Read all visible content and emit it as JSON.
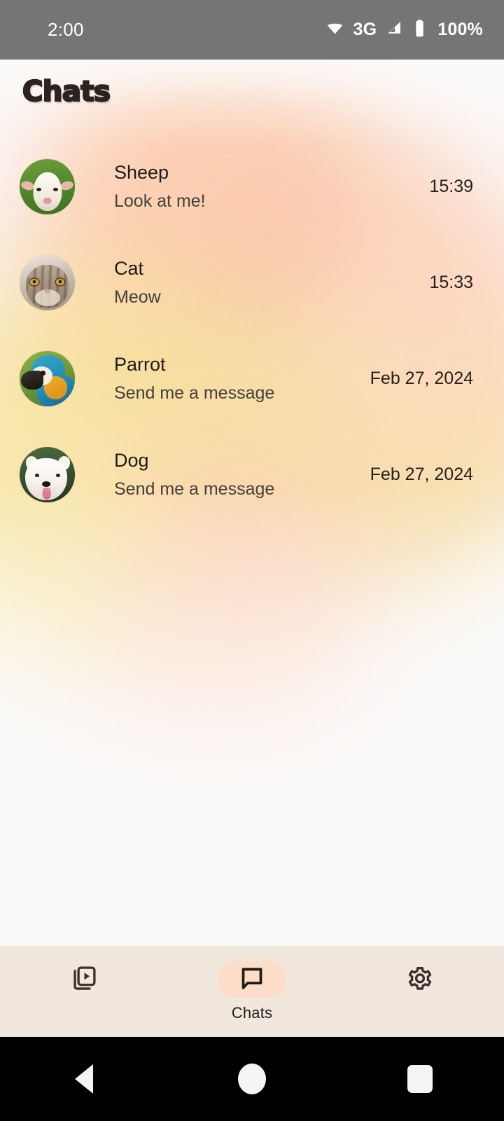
{
  "status_bar": {
    "clock": "2:00",
    "network": "3G",
    "battery": "100%",
    "wifi_icon": "wifi-icon",
    "signal_icon": "signal-icon",
    "battery_icon": "battery-icon",
    "background_color": "#757575",
    "text_color": "#ffffff"
  },
  "header": {
    "title": "Chats",
    "title_color": "#2b2320"
  },
  "chats": [
    {
      "name": "Sheep",
      "message": "Look at me!",
      "time": "15:39",
      "avatar": "sheep-avatar"
    },
    {
      "name": "Cat",
      "message": "Meow",
      "time": "15:33",
      "avatar": "cat-avatar"
    },
    {
      "name": "Parrot",
      "message": "Send me a message",
      "time": "Feb 27, 2024",
      "avatar": "parrot-avatar"
    },
    {
      "name": "Dog",
      "message": "Send me a message",
      "time": "Feb 27, 2024",
      "avatar": "dog-avatar"
    }
  ],
  "bottom_nav": {
    "background_color": "#f2e7dd",
    "active_pill_color": "#fbddc8",
    "items": [
      {
        "label": "",
        "icon": "video-library-icon",
        "active": false
      },
      {
        "label": "Chats",
        "icon": "chat-bubble-icon",
        "active": true
      },
      {
        "label": "",
        "icon": "gear-icon",
        "active": false
      }
    ]
  },
  "system_nav": {
    "back": "back-triangle-icon",
    "home": "home-circle-icon",
    "recents": "recents-square-icon"
  },
  "theme": {
    "accent": "#fbddc8",
    "surface": "#fbfafa",
    "nav_surface": "#f2e7dd",
    "on_surface": "#1f1b18"
  }
}
